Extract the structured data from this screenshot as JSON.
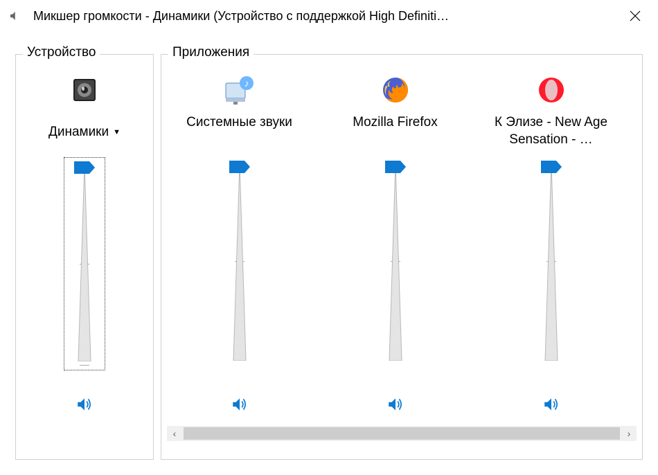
{
  "window": {
    "title": "Микшер громкости - Динамики (Устройство с поддержкой High Definiti…"
  },
  "device": {
    "group_label": "Устройство",
    "name": "Динамики",
    "icon": "speaker-device-icon",
    "volume": 100,
    "muted": false
  },
  "apps": {
    "group_label": "Приложения",
    "items": [
      {
        "name": "Системные звуки",
        "icon": "system-sounds-icon",
        "volume": 100,
        "muted": false
      },
      {
        "name": "Mozilla Firefox",
        "icon": "firefox-icon",
        "volume": 100,
        "muted": false
      },
      {
        "name": "К Элизе - New Age Sensation - …",
        "icon": "opera-icon",
        "volume": 100,
        "muted": false
      }
    ]
  },
  "colors": {
    "accent": "#0e7ad1",
    "thumb": "#0e7ad1"
  }
}
